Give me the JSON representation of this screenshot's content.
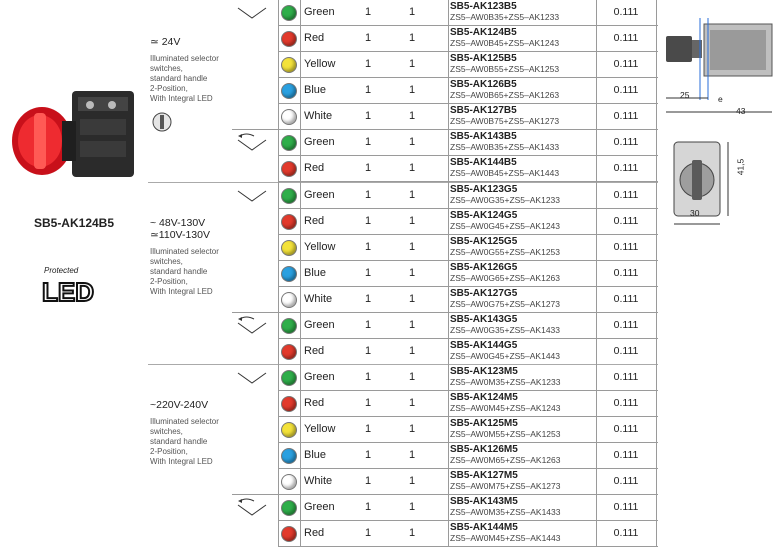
{
  "product": {
    "name": "SB5-AK124B5",
    "logo_small": "Protected",
    "logo_big": "LED"
  },
  "drawings": {
    "dim_25": "25",
    "dim_e": "e",
    "dim_43": "43",
    "dim_41_5": "41,5",
    "dim_30": "30"
  },
  "groups": [
    {
      "voltage": [
        "≃ 24V"
      ],
      "description": [
        "Illuminated selector",
        "switches,",
        "standard handle",
        "2-Position,",
        "With Integral LED"
      ],
      "subgroups": [
        {
          "symbol": "maintained-v",
          "rows": [
            {
              "colour": "Green",
              "lamp": "#2fae4a",
              "q1": "1",
              "q2": "1",
              "ref": "SB5-AK123B5",
              "parts": "ZS5–AW0B35+ZS5–AK1233",
              "weight": "0.111"
            },
            {
              "colour": "Red",
              "lamp": "#e23a2c",
              "q1": "1",
              "q2": "1",
              "ref": "SB5-AK124B5",
              "parts": "ZS5–AW0B45+ZS5–AK1243",
              "weight": "0.111"
            },
            {
              "colour": "Yellow",
              "lamp": "#f3e23a",
              "q1": "1",
              "q2": "1",
              "ref": "SB5-AK125B5",
              "parts": "ZS5–AW0B55+ZS5–AK1253",
              "weight": "0.111"
            },
            {
              "colour": "Blue",
              "lamp": "#2aa0e0",
              "q1": "1",
              "q2": "1",
              "ref": "SB5-AK126B5",
              "parts": "ZS5–AW0B65+ZS5–AK1263",
              "weight": "0.111"
            },
            {
              "colour": "White",
              "lamp": "#ffffff",
              "q1": "1",
              "q2": "1",
              "ref": "SB5-AK127B5",
              "parts": "ZS5–AW0B75+ZS5–AK1273",
              "weight": "0.111"
            }
          ]
        },
        {
          "symbol": "spring-return",
          "rows": [
            {
              "colour": "Green",
              "lamp": "#2fae4a",
              "q1": "1",
              "q2": "1",
              "ref": "SB5-AK143B5",
              "parts": "ZS5–AW0B35+ZS5–AK1433",
              "weight": "0.111"
            },
            {
              "colour": "Red",
              "lamp": "#e23a2c",
              "q1": "1",
              "q2": "1",
              "ref": "SB5-AK144B5",
              "parts": "ZS5–AW0B45+ZS5–AK1443",
              "weight": "0.111"
            }
          ]
        }
      ]
    },
    {
      "voltage": [
        "~ 48V-130V",
        "≃110V-130V"
      ],
      "description": [
        "Illuminated selector",
        "switches,",
        "standard handle",
        "2-Position,",
        "With Integral LED"
      ],
      "subgroups": [
        {
          "symbol": "maintained-v",
          "rows": [
            {
              "colour": "Green",
              "lamp": "#2fae4a",
              "q1": "1",
              "q2": "1",
              "ref": "SB5-AK123G5",
              "parts": "ZS5–AW0G35+ZS5–AK1233",
              "weight": "0.111"
            },
            {
              "colour": "Red",
              "lamp": "#e23a2c",
              "q1": "1",
              "q2": "1",
              "ref": "SB5-AK124G5",
              "parts": "ZS5–AW0G45+ZS5–AK1243",
              "weight": "0.111"
            },
            {
              "colour": "Yellow",
              "lamp": "#f3e23a",
              "q1": "1",
              "q2": "1",
              "ref": "SB5-AK125G5",
              "parts": "ZS5–AW0G55+ZS5–AK1253",
              "weight": "0.111"
            },
            {
              "colour": "Blue",
              "lamp": "#2aa0e0",
              "q1": "1",
              "q2": "1",
              "ref": "SB5-AK126G5",
              "parts": "ZS5–AW0G65+ZS5–AK1263",
              "weight": "0.111"
            },
            {
              "colour": "White",
              "lamp": "#ffffff",
              "q1": "1",
              "q2": "1",
              "ref": "SB5-AK127G5",
              "parts": "ZS5–AW0G75+ZS5–AK1273",
              "weight": "0.111"
            }
          ]
        },
        {
          "symbol": "spring-return",
          "rows": [
            {
              "colour": "Green",
              "lamp": "#2fae4a",
              "q1": "1",
              "q2": "1",
              "ref": "SB5-AK143G5",
              "parts": "ZS5–AW0G35+ZS5–AK1433",
              "weight": "0.111"
            },
            {
              "colour": "Red",
              "lamp": "#e23a2c",
              "q1": "1",
              "q2": "1",
              "ref": "SB5-AK144G5",
              "parts": "ZS5–AW0G45+ZS5–AK1443",
              "weight": "0.111"
            }
          ]
        }
      ]
    },
    {
      "voltage": [
        "~220V-240V"
      ],
      "description": [
        "Illuminated selector",
        "switches,",
        "standard handle",
        "2-Position,",
        "With Integral LED"
      ],
      "subgroups": [
        {
          "symbol": "maintained-v",
          "rows": [
            {
              "colour": "Green",
              "lamp": "#2fae4a",
              "q1": "1",
              "q2": "1",
              "ref": "SB5-AK123M5",
              "parts": "ZS5–AW0M35+ZS5–AK1233",
              "weight": "0.111"
            },
            {
              "colour": "Red",
              "lamp": "#e23a2c",
              "q1": "1",
              "q2": "1",
              "ref": "SB5-AK124M5",
              "parts": "ZS5–AW0M45+ZS5–AK1243",
              "weight": "0.111"
            },
            {
              "colour": "Yellow",
              "lamp": "#f3e23a",
              "q1": "1",
              "q2": "1",
              "ref": "SB5-AK125M5",
              "parts": "ZS5–AW0M55+ZS5–AK1253",
              "weight": "0.111"
            },
            {
              "colour": "Blue",
              "lamp": "#2aa0e0",
              "q1": "1",
              "q2": "1",
              "ref": "SB5-AK126M5",
              "parts": "ZS5–AW0M65+ZS5–AK1263",
              "weight": "0.111"
            },
            {
              "colour": "White",
              "lamp": "#ffffff",
              "q1": "1",
              "q2": "1",
              "ref": "SB5-AK127M5",
              "parts": "ZS5–AW0M75+ZS5–AK1273",
              "weight": "0.111"
            }
          ]
        },
        {
          "symbol": "spring-return",
          "rows": [
            {
              "colour": "Green",
              "lamp": "#2fae4a",
              "q1": "1",
              "q2": "1",
              "ref": "SB5-AK143M5",
              "parts": "ZS5–AW0M35+ZS5–AK1433",
              "weight": "0.111"
            },
            {
              "colour": "Red",
              "lamp": "#e23a2c",
              "q1": "1",
              "q2": "1",
              "ref": "SB5-AK144M5",
              "parts": "ZS5–AW0M45+ZS5–AK1443",
              "weight": "0.111"
            }
          ]
        }
      ]
    }
  ]
}
